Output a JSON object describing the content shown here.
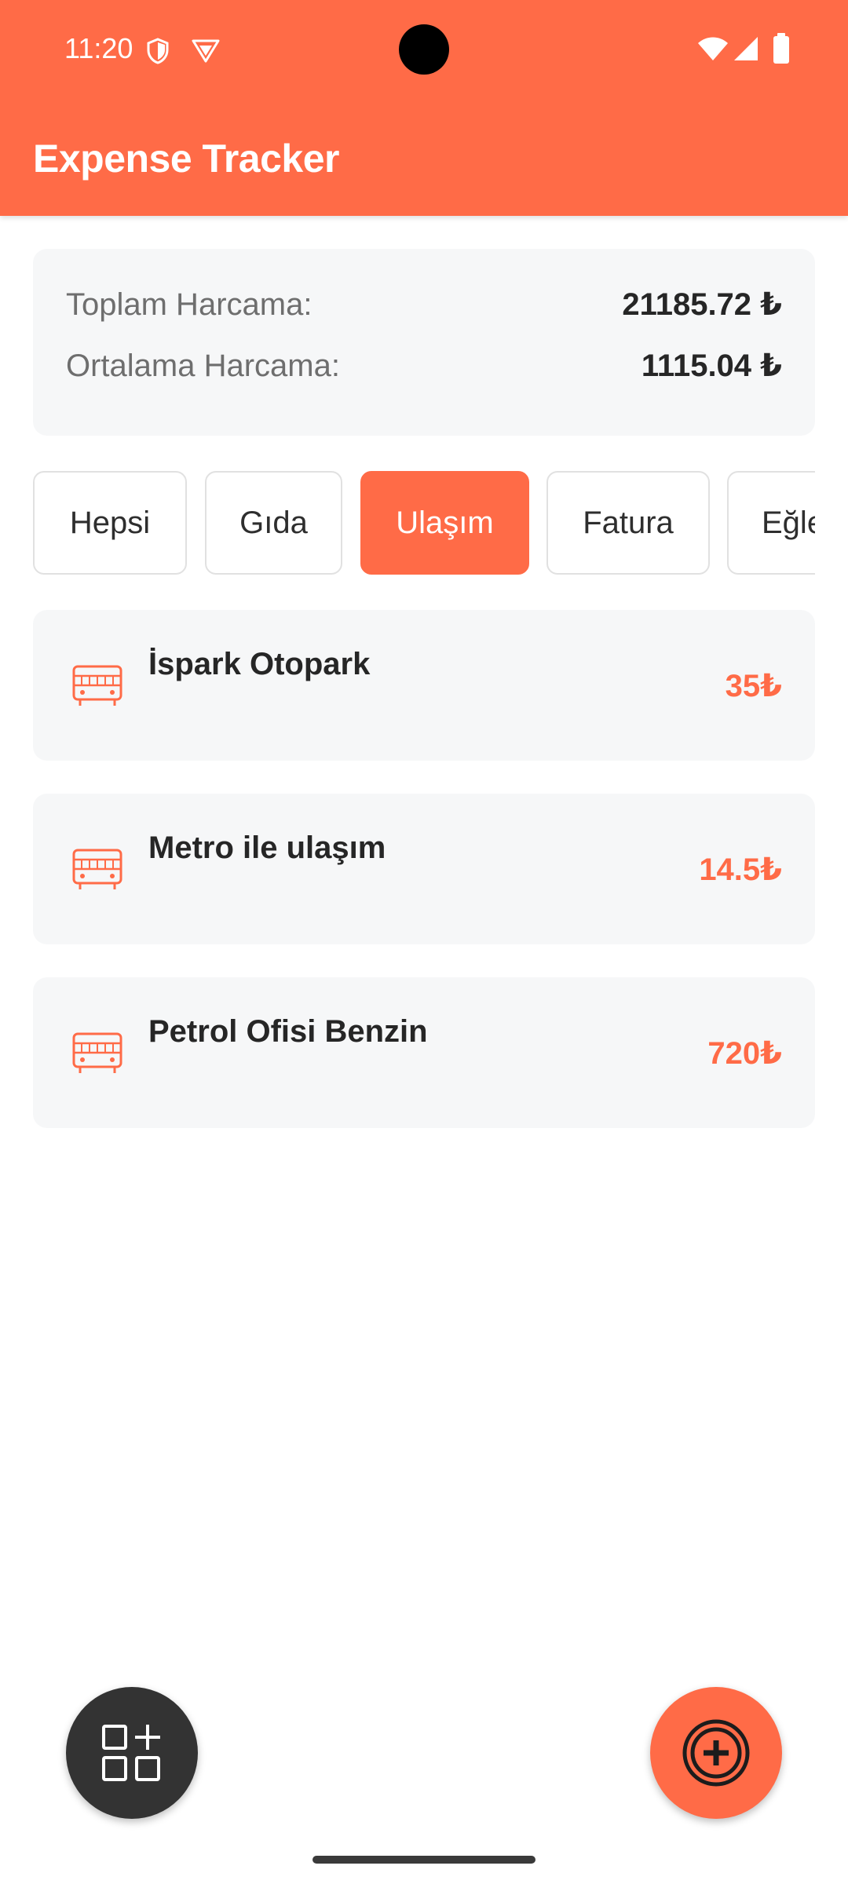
{
  "status_bar": {
    "time": "11:20",
    "left_icons": [
      "shield-icon",
      "vpn-icon"
    ],
    "right_icons": [
      "wifi-icon",
      "signal-icon",
      "battery-icon"
    ]
  },
  "app": {
    "title": "Expense Tracker",
    "accent_color": "#FF6B47"
  },
  "summary": {
    "total_label": "Toplam Harcama:",
    "total_value": "21185.72 ₺",
    "average_label": "Ortalama Harcama:",
    "average_value": "1115.04 ₺"
  },
  "filters": {
    "selected": "Ulaşım",
    "items": [
      {
        "label": "Hepsi"
      },
      {
        "label": "Gıda"
      },
      {
        "label": "Ulaşım"
      },
      {
        "label": "Fatura"
      },
      {
        "label": "Eğle"
      }
    ]
  },
  "expenses": [
    {
      "icon": "bus-icon",
      "name": "İspark Otopark",
      "amount": "35₺"
    },
    {
      "icon": "bus-icon",
      "name": "Metro ile ulaşım",
      "amount": "14.5₺"
    },
    {
      "icon": "bus-icon",
      "name": "Petrol Ofisi Benzin",
      "amount": "720₺"
    }
  ],
  "actions": {
    "left_fab_icon": "apps-add-icon",
    "right_fab_icon": "plus-circle-icon"
  }
}
